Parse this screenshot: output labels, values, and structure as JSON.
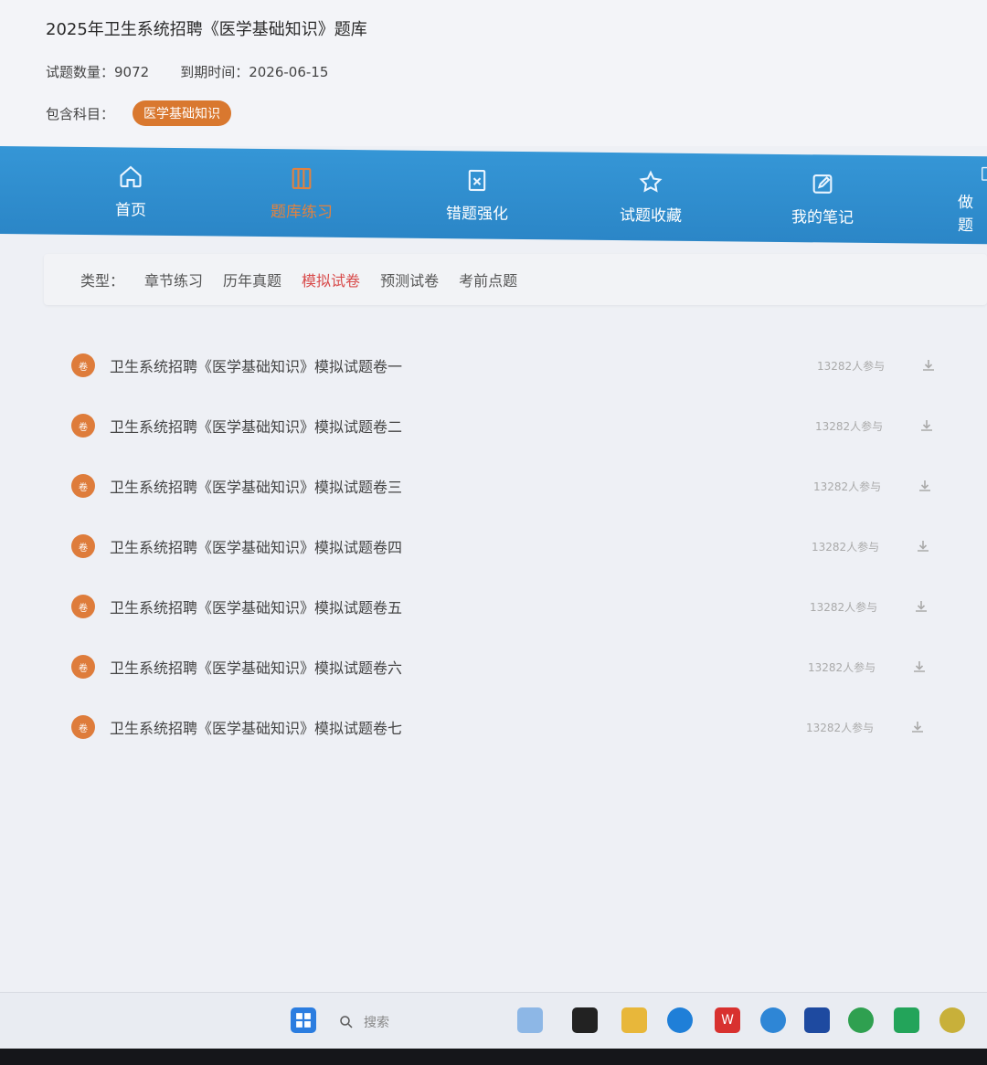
{
  "header": {
    "title": "2025年卫生系统招聘《医学基础知识》题库",
    "question_count_label": "试题数量：9072",
    "expiry_label": "到期时间：2026-06-15",
    "subjects_label": "包含科目：",
    "subject_chip": "医学基础知识"
  },
  "nav": {
    "items": [
      {
        "label": "首页",
        "icon": "home-icon"
      },
      {
        "label": "题库练习",
        "icon": "book-icon"
      },
      {
        "label": "错题强化",
        "icon": "wrong-icon"
      },
      {
        "label": "试题收藏",
        "icon": "star-icon"
      },
      {
        "label": "我的笔记",
        "icon": "note-icon"
      },
      {
        "label": "做题",
        "icon": "doc-icon"
      }
    ],
    "active_index": 1
  },
  "filter": {
    "label": "类型：",
    "options": [
      "章节练习",
      "历年真题",
      "模拟试卷",
      "预测试卷",
      "考前点题"
    ],
    "active_index": 2
  },
  "papers": [
    {
      "title": "卫生系统招聘《医学基础知识》模拟试题卷一",
      "count": "13282人参与"
    },
    {
      "title": "卫生系统招聘《医学基础知识》模拟试题卷二",
      "count": "13282人参与"
    },
    {
      "title": "卫生系统招聘《医学基础知识》模拟试题卷三",
      "count": "13282人参与"
    },
    {
      "title": "卫生系统招聘《医学基础知识》模拟试题卷四",
      "count": "13282人参与"
    },
    {
      "title": "卫生系统招聘《医学基础知识》模拟试题卷五",
      "count": "13282人参与"
    },
    {
      "title": "卫生系统招聘《医学基础知识》模拟试题卷六",
      "count": "13282人参与"
    },
    {
      "title": "卫生系统招聘《医学基础知识》模拟试题卷七",
      "count": "13282人参与"
    }
  ],
  "taskbar": {
    "search_placeholder": "搜索"
  },
  "colors": {
    "nav_blue": "#2f8fd0",
    "accent_orange": "#de7c3b",
    "active_red": "#d84a4a"
  }
}
